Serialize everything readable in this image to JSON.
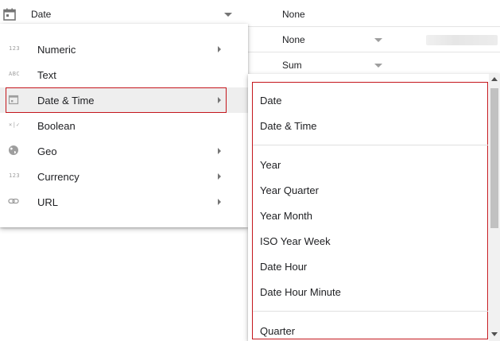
{
  "rows": [
    {
      "type": "Date",
      "aggregation": "None",
      "type_icon": "calendar-icon"
    },
    {
      "aggregation": "None"
    },
    {
      "aggregation": "Sum"
    }
  ],
  "type_menu": {
    "items": [
      {
        "icon": "123",
        "icon_name": "numeric-icon",
        "label": "Numeric",
        "has_submenu": true
      },
      {
        "icon": "ABC",
        "icon_name": "text-icon",
        "label": "Text",
        "has_submenu": false
      },
      {
        "icon": "",
        "icon_name": "calendar-icon",
        "label": "Date & Time",
        "has_submenu": true,
        "active": true
      },
      {
        "icon": "×|✓",
        "icon_name": "boolean-icon",
        "label": "Boolean",
        "has_submenu": false
      },
      {
        "icon": "",
        "icon_name": "globe-icon",
        "label": "Geo",
        "has_submenu": true
      },
      {
        "icon": "123",
        "icon_name": "currency-icon",
        "label": "Currency",
        "has_submenu": true
      },
      {
        "icon": "",
        "icon_name": "link-icon",
        "label": "URL",
        "has_submenu": true
      }
    ]
  },
  "submenu": {
    "items": [
      "Date",
      "Date & Time",
      "Year",
      "Year Quarter",
      "Year Month",
      "ISO Year Week",
      "Date Hour",
      "Date Hour Minute",
      "Quarter"
    ]
  },
  "colors": {
    "highlight_border": "#c4161c",
    "active_bg": "#eeeeee"
  }
}
